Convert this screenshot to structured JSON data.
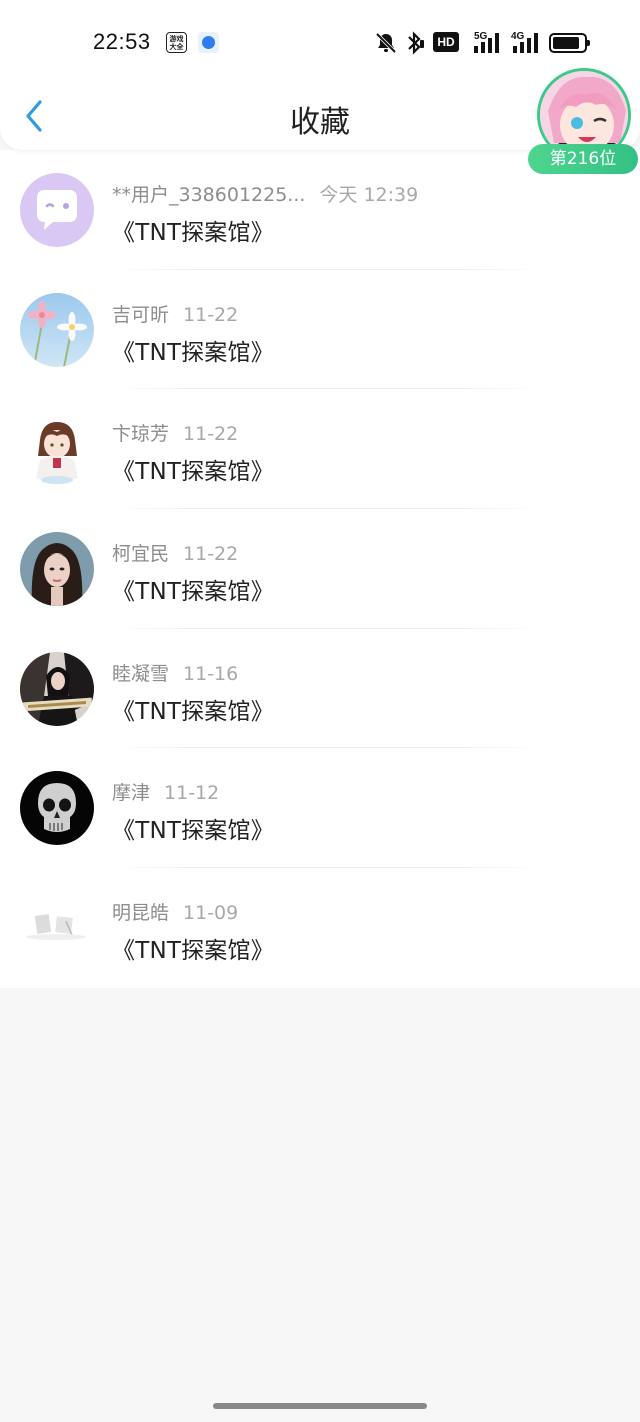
{
  "status_bar": {
    "time": "22:53",
    "app_icon_1_text": "游戏大全",
    "icons": [
      "mute-bell-icon",
      "bluetooth-icon",
      "hd-icon",
      "signal-5g-icon",
      "signal-4g-icon",
      "battery-icon"
    ],
    "hd_label": "HD",
    "net1_label": "5G",
    "net2_label": "4G"
  },
  "nav": {
    "title": "收藏",
    "back_icon": "chevron-left-icon",
    "accent": "#2f9be0"
  },
  "rank": {
    "label": "第216位",
    "color": "#3ec88a"
  },
  "items": [
    {
      "user": "**用户_338601225...",
      "time": "今天 12:39",
      "title": "《TNT探案馆》",
      "avatar": "chat-bubble-avatar"
    },
    {
      "user": "吉可昕",
      "time": "11-22",
      "title": "《TNT探案馆》",
      "avatar": "flowers-avatar"
    },
    {
      "user": "卞琼芳",
      "time": "11-22",
      "title": "《TNT探案馆》",
      "avatar": "anime-girl-avatar"
    },
    {
      "user": "柯宜民",
      "time": "11-22",
      "title": "《TNT探案馆》",
      "avatar": "woman-portrait-avatar"
    },
    {
      "user": "睦凝雪",
      "time": "11-16",
      "title": "《TNT探案馆》",
      "avatar": "dark-photo-avatar"
    },
    {
      "user": "摩津",
      "time": "11-12",
      "title": "《TNT探案馆》",
      "avatar": "skull-avatar"
    },
    {
      "user": "明昆皓",
      "time": "11-09",
      "title": "《TNT探案馆》",
      "avatar": "sketch-avatar"
    }
  ]
}
